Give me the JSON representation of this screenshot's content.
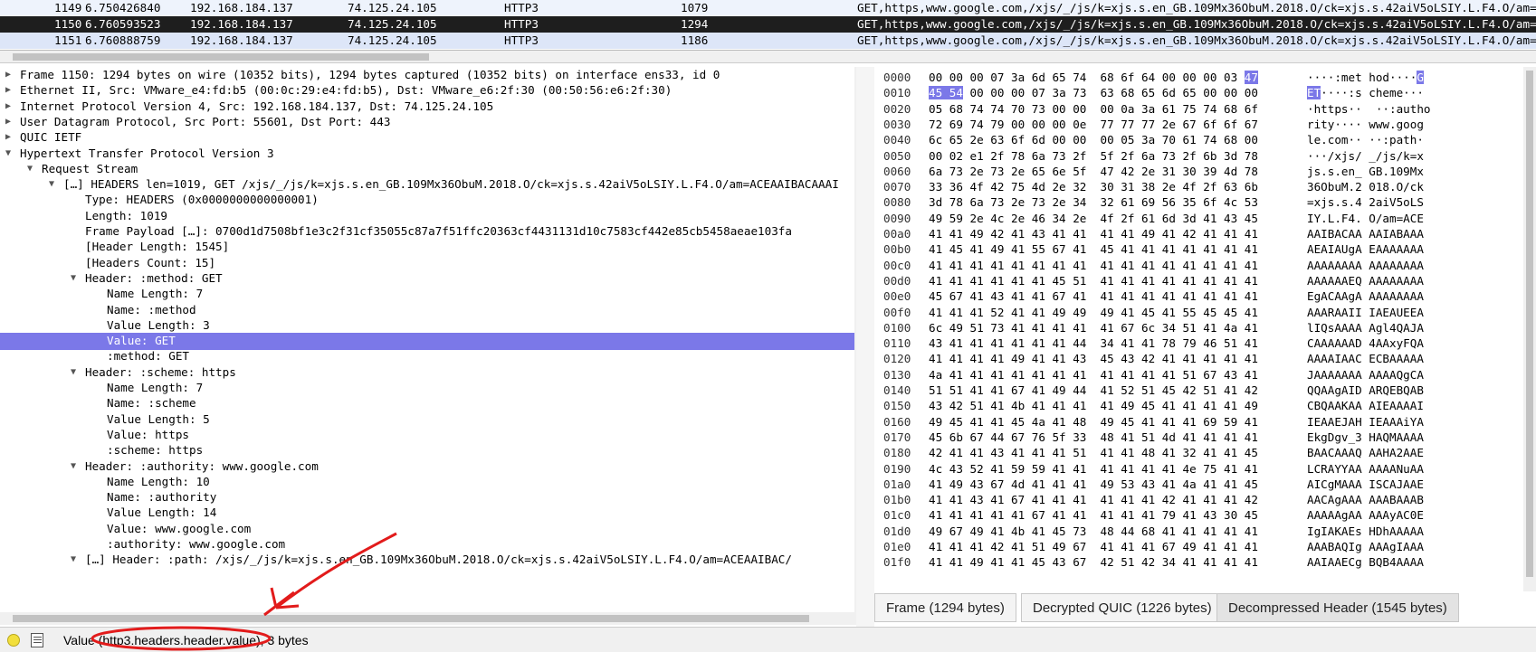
{
  "packet_list": {
    "rows": [
      {
        "no": "1149",
        "time": "6.750426840",
        "src": "192.168.184.137",
        "dst": "74.125.24.105",
        "proto": "HTTP3",
        "len": "1079",
        "info": "GET,https,www.google.com,/xjs/_/js/k=xjs.s.en_GB.109Mx36ObuM.2018.O/ck=xjs.s.42aiV5oLSIY.L.F4.O/am=ACEAAIBACAAA"
      },
      {
        "no": "1150",
        "time": "6.760593523",
        "src": "192.168.184.137",
        "dst": "74.125.24.105",
        "proto": "HTTP3",
        "len": "1294",
        "info": "GET,https,www.google.com,/xjs/_/js/k=xjs.s.en_GB.109Mx36ObuM.2018.O/ck=xjs.s.42aiV5oLSIY.L.F4.O/am=ACEAAIBACAAA"
      },
      {
        "no": "1151",
        "time": "6.760888759",
        "src": "192.168.184.137",
        "dst": "74.125.24.105",
        "proto": "HTTP3",
        "len": "1186",
        "info": "GET,https,www.google.com,/xjs/_/js/k=xjs.s.en_GB.109Mx36ObuM.2018.O/ck=xjs.s.42aiV5oLSIY.L.F4.O/am=ACEAAIBACAAA"
      }
    ]
  },
  "tree": [
    {
      "text": "Frame 1150: 1294 bytes on wire (10352 bits), 1294 bytes captured (10352 bits) on interface ens33, id 0",
      "twisty": "▶"
    },
    {
      "text": "Ethernet II, Src: VMware_e4:fd:b5 (00:0c:29:e4:fd:b5), Dst: VMware_e6:2f:30 (00:50:56:e6:2f:30)",
      "twisty": "▶"
    },
    {
      "text": "Internet Protocol Version 4, Src: 192.168.184.137, Dst: 74.125.24.105",
      "twisty": "▶"
    },
    {
      "text": "User Datagram Protocol, Src Port: 55601, Dst Port: 443",
      "twisty": "▶"
    },
    {
      "text": "QUIC IETF",
      "twisty": "▶"
    },
    {
      "text": "Hypertext Transfer Protocol Version 3",
      "twisty": "▼"
    },
    {
      "text": "Request Stream",
      "twisty": "▼"
    },
    {
      "text": "[…] HEADERS len=1019, GET /xjs/_/js/k=xjs.s.en_GB.109Mx36ObuM.2018.O/ck=xjs.s.42aiV5oLSIY.L.F4.O/am=ACEAAIBACAAAI",
      "twisty": "▼"
    },
    {
      "text": "Type: HEADERS (0x0000000000000001)",
      "twisty": ""
    },
    {
      "text": "Length: 1019",
      "twisty": ""
    },
    {
      "text": "Frame Payload […]: 0700d1d7508bf1e3c2f31cf35055c87a7f51ffc20363cf4431131d10c7583cf442e85cb5458aeae103fa",
      "twisty": ""
    },
    {
      "text": "[Header Length: 1545]",
      "twisty": ""
    },
    {
      "text": "[Headers Count: 15]",
      "twisty": ""
    },
    {
      "text": "Header: :method: GET",
      "twisty": "▼"
    },
    {
      "text": "Name Length: 7",
      "twisty": ""
    },
    {
      "text": "Name: :method",
      "twisty": ""
    },
    {
      "text": "Value Length: 3",
      "twisty": ""
    },
    {
      "text": "Value: GET",
      "twisty": ""
    },
    {
      "text": ":method: GET",
      "twisty": ""
    },
    {
      "text": "Header: :scheme: https",
      "twisty": "▼"
    },
    {
      "text": "Name Length: 7",
      "twisty": ""
    },
    {
      "text": "Name: :scheme",
      "twisty": ""
    },
    {
      "text": "Value Length: 5",
      "twisty": ""
    },
    {
      "text": "Value: https",
      "twisty": ""
    },
    {
      "text": ":scheme: https",
      "twisty": ""
    },
    {
      "text": "Header: :authority: www.google.com",
      "twisty": "▼"
    },
    {
      "text": "Name Length: 10",
      "twisty": ""
    },
    {
      "text": "Name: :authority",
      "twisty": ""
    },
    {
      "text": "Value Length: 14",
      "twisty": ""
    },
    {
      "text": "Value: www.google.com",
      "twisty": ""
    },
    {
      "text": ":authority: www.google.com",
      "twisty": ""
    },
    {
      "text": "[…] Header: :path: /xjs/_/js/k=xjs.s.en_GB.109Mx36ObuM.2018.O/ck=xjs.s.42aiV5oLSIY.L.F4.O/am=ACEAAIBAC/",
      "twisty": "▼"
    }
  ],
  "hex": [
    {
      "off": "0000",
      "bytes": "00 00 00 07 3a 6d 65 74  68 6f 64 00 00 00 03 47",
      "ascii": "····:met hod····G"
    },
    {
      "off": "0010",
      "bytes": "45 54 00 00 00 07 3a 73  63 68 65 6d 65 00 00 00",
      "ascii": "ET····:s cheme···"
    },
    {
      "off": "0020",
      "bytes": "05 68 74 74 70 73 00 00  00 0a 3a 61 75 74 68 6f",
      "ascii": "·https··  ··:autho"
    },
    {
      "off": "0030",
      "bytes": "72 69 74 79 00 00 00 0e  77 77 77 2e 67 6f 6f 67",
      "ascii": "rity···· www.goog"
    },
    {
      "off": "0040",
      "bytes": "6c 65 2e 63 6f 6d 00 00  00 05 3a 70 61 74 68 00",
      "ascii": "le.com·· ··:path·"
    },
    {
      "off": "0050",
      "bytes": "00 02 e1 2f 78 6a 73 2f  5f 2f 6a 73 2f 6b 3d 78",
      "ascii": "···/xjs/ _/js/k=x"
    },
    {
      "off": "0060",
      "bytes": "6a 73 2e 73 2e 65 6e 5f  47 42 2e 31 30 39 4d 78",
      "ascii": "js.s.en_ GB.109Mx"
    },
    {
      "off": "0070",
      "bytes": "33 36 4f 42 75 4d 2e 32  30 31 38 2e 4f 2f 63 6b",
      "ascii": "36ObuM.2 018.O/ck"
    },
    {
      "off": "0080",
      "bytes": "3d 78 6a 73 2e 73 2e 34  32 61 69 56 35 6f 4c 53",
      "ascii": "=xjs.s.4 2aiV5oLS"
    },
    {
      "off": "0090",
      "bytes": "49 59 2e 4c 2e 46 34 2e  4f 2f 61 6d 3d 41 43 45",
      "ascii": "IY.L.F4. O/am=ACE"
    },
    {
      "off": "00a0",
      "bytes": "41 41 49 42 41 43 41 41  41 41 49 41 42 41 41 41",
      "ascii": "AAIBACAA AAIABAAA"
    },
    {
      "off": "00b0",
      "bytes": "41 45 41 49 41 55 67 41  45 41 41 41 41 41 41 41",
      "ascii": "AEAIAUgA EAAAAAAA"
    },
    {
      "off": "00c0",
      "bytes": "41 41 41 41 41 41 41 41  41 41 41 41 41 41 41 41",
      "ascii": "AAAAAAAA AAAAAAAA"
    },
    {
      "off": "00d0",
      "bytes": "41 41 41 41 41 41 45 51  41 41 41 41 41 41 41 41",
      "ascii": "AAAAAAEQ AAAAAAAA"
    },
    {
      "off": "00e0",
      "bytes": "45 67 41 43 41 41 67 41  41 41 41 41 41 41 41 41",
      "ascii": "EgACAAgA AAAAAAAA"
    },
    {
      "off": "00f0",
      "bytes": "41 41 41 52 41 41 49 49  49 41 45 41 55 45 45 41",
      "ascii": "AAARAAII IAEAUEEA"
    },
    {
      "off": "0100",
      "bytes": "6c 49 51 73 41 41 41 41  41 67 6c 34 51 41 4a 41",
      "ascii": "lIQsAAAA Agl4QAJA"
    },
    {
      "off": "0110",
      "bytes": "43 41 41 41 41 41 41 44  34 41 41 78 79 46 51 41",
      "ascii": "CAAAAAAD 4AAxyFQA"
    },
    {
      "off": "0120",
      "bytes": "41 41 41 41 49 41 41 43  45 43 42 41 41 41 41 41",
      "ascii": "AAAAIAAC ECBAAAAA"
    },
    {
      "off": "0130",
      "bytes": "4a 41 41 41 41 41 41 41  41 41 41 41 51 67 43 41",
      "ascii": "JAAAAAAA AAAAQgCA"
    },
    {
      "off": "0140",
      "bytes": "51 51 41 41 67 41 49 44  41 52 51 45 42 51 41 42",
      "ascii": "QQAAgAID ARQEBQAB"
    },
    {
      "off": "0150",
      "bytes": "43 42 51 41 4b 41 41 41  41 49 45 41 41 41 41 49",
      "ascii": "CBQAAKAA AIEAAAAI"
    },
    {
      "off": "0160",
      "bytes": "49 45 41 41 45 4a 41 48  49 45 41 41 41 69 59 41",
      "ascii": "IEAAEJAH IEAAAiYA"
    },
    {
      "off": "0170",
      "bytes": "45 6b 67 44 67 76 5f 33  48 41 51 4d 41 41 41 41",
      "ascii": "EkgDgv_3 HAQMAAAA"
    },
    {
      "off": "0180",
      "bytes": "42 41 41 43 41 41 41 51  41 41 48 41 32 41 41 45",
      "ascii": "BAACAAAQ AAHA2AAE"
    },
    {
      "off": "0190",
      "bytes": "4c 43 52 41 59 59 41 41  41 41 41 41 4e 75 41 41",
      "ascii": "LCRAYYAA AAAANuAA"
    },
    {
      "off": "01a0",
      "bytes": "41 49 43 67 4d 41 41 41  49 53 43 41 4a 41 41 45",
      "ascii": "AICgMAAA ISCAJAAE"
    },
    {
      "off": "01b0",
      "bytes": "41 41 43 41 67 41 41 41  41 41 41 42 41 41 41 42",
      "ascii": "AACAgAAA AAABAAAB"
    },
    {
      "off": "01c0",
      "bytes": "41 41 41 41 41 67 41 41  41 41 41 79 41 43 30 45",
      "ascii": "AAAAAgAA AAAyAC0E"
    },
    {
      "off": "01d0",
      "bytes": "49 67 49 41 4b 41 45 73  48 44 68 41 41 41 41 41",
      "ascii": "IgIAKAEs HDhAAAAA"
    },
    {
      "off": "01e0",
      "bytes": "41 41 41 42 41 51 49 67  41 41 41 67 49 41 41 41",
      "ascii": "AAABAQIg AAAgIAAA"
    },
    {
      "off": "01f0",
      "bytes": "41 41 49 41 41 45 43 67  42 51 42 34 41 41 41 41",
      "ascii": "AAIAAECg BQB4AAAA"
    }
  ],
  "tabs": [
    "Frame (1294 bytes)",
    "Decrypted QUIC (1226 bytes)",
    "Decompressed Header (1545 bytes)"
  ],
  "status": {
    "text": "Value (http3.headers.header.value), 3 bytes"
  }
}
